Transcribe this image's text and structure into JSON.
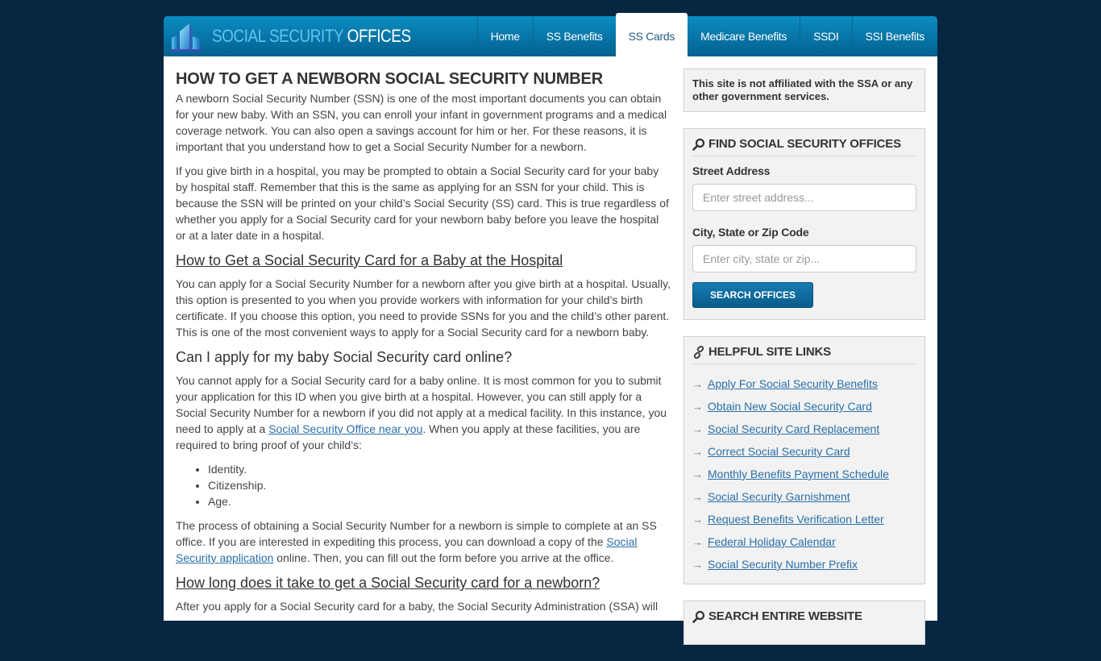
{
  "colors": {
    "page_background": "#062641",
    "header_blue": "#0774a6",
    "logo_light": "#5fc4ee",
    "link": "#2a6fa8",
    "active_tab_text": "#255c86",
    "sidebar_box": "#f2f2f2",
    "button": "#0a5c8c"
  },
  "header": {
    "logo_text_light": "SOCIAL SECURITY ",
    "logo_text_bold": "OFFICES",
    "logo_icon": "building-icon",
    "nav": [
      {
        "label": "Home",
        "active": false
      },
      {
        "label": "SS Benefits",
        "active": false
      },
      {
        "label": "SS Cards",
        "active": true
      },
      {
        "label": "Medicare Benefits",
        "active": false
      },
      {
        "label": "SSDI",
        "active": false
      },
      {
        "label": "SSI Benefits",
        "active": false
      }
    ]
  },
  "main": {
    "title": "HOW TO GET A NEWBORN SOCIAL SECURITY NUMBER",
    "p1": "A newborn Social Security Number (SSN) is one of the most important documents you can obtain for your new baby. With an SSN, you can enroll your infant in government programs and a medical coverage network. You can also open a savings account for him or her. For these reasons, it is important that you understand how to get a Social Security Number for a newborn.",
    "p2": "If you give birth in a hospital, you may be prompted to obtain a Social Security card for your baby by hospital staff. Remember that this is the same as applying for an SSN for your child. This is because the SSN will be printed on your child’s Social Security (SS) card. This is true regardless of whether you apply for a Social Security card for your newborn baby before you leave the hospital or at a later date in a hospital.",
    "h2_hospital": "How to Get a Social Security Card for a Baby at the Hospital",
    "p3": "You can apply for a Social Security Number for a newborn after you give birth at a hospital. Usually, this option is presented to you when you provide workers with information for your child’s birth certificate. If you choose this option, you need to provide SSNs for you and the child’s other parent. This is one of the most convenient ways to apply for a Social Security card for a newborn baby.",
    "h2_online": "Can I apply for my baby Social Security card online?",
    "p4_before": "You cannot apply for a Social Security card for a baby online. It is most common for you to submit your application for this ID when you give birth at a hospital. However, you can still apply for a Social Security Number for a newborn if you did not apply at a medical facility. In this instance, you need to apply at a ",
    "p4_link": "Social Security Office near you",
    "p4_after": ". When you apply at these facilities, you are required to bring proof of your child’s:",
    "proof_list": [
      "Identity.",
      "Citizenship.",
      "Age."
    ],
    "p5_before": "The process of obtaining a Social Security Number for a newborn is simple to complete at an SS office. If you are interested in expediting this process, you can download a copy of the ",
    "p5_link": "Social Security application",
    "p5_after": " online. Then, you can fill out the form before you arrive at the office.",
    "h2_how_long": "How long does it take to get a Social Security card for a newborn?",
    "p6": "After you apply for a Social Security card for a baby, the Social Security Administration (SSA) will"
  },
  "sidebar": {
    "notice": "This site is not affiliated with the SSA or any other government services.",
    "find": {
      "title": "FIND SOCIAL SECURITY OFFICES",
      "street_label": "Street Address",
      "street_placeholder": "Enter street address...",
      "street_value": "",
      "city_label": "City, State or Zip Code",
      "city_placeholder": "Enter city, state or zip...",
      "city_value": "",
      "button": "SEARCH OFFICES"
    },
    "links": {
      "title": "HELPFUL SITE LINKS",
      "items": [
        "Apply For Social Security Benefits",
        "Obtain New Social Security Card",
        "Social Security Card Replacement",
        "Correct Social Security Card",
        "Monthly Benefits Payment Schedule",
        "Social Security Garnishment",
        "Request Benefits Verification Letter",
        "Federal Holiday Calendar",
        "Social Security Number Prefix"
      ],
      "arrow_glyph": "→"
    },
    "search_site": {
      "title": "SEARCH ENTIRE WEBSITE"
    }
  }
}
